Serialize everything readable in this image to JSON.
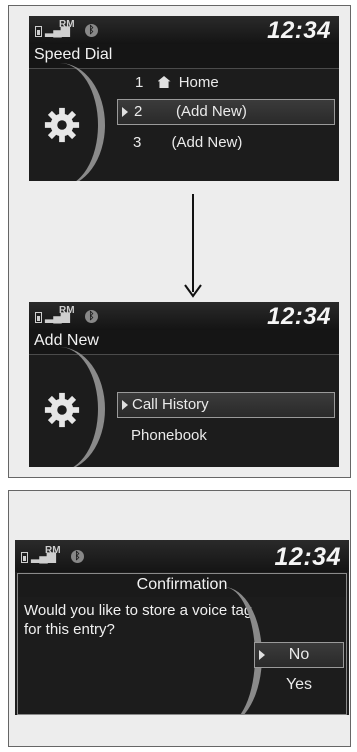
{
  "screens": {
    "speed_dial": {
      "clock": "12:34",
      "status_rm": "RM",
      "title": "Speed Dial",
      "items": [
        {
          "num": "1",
          "label": "Home"
        },
        {
          "num": "2",
          "label": "(Add New)"
        },
        {
          "num": "3",
          "label": "(Add New)"
        }
      ]
    },
    "add_new": {
      "clock": "12:34",
      "status_rm": "RM",
      "title": "Add New",
      "items": [
        {
          "label": "Call History"
        },
        {
          "label": "Phonebook"
        }
      ]
    },
    "confirmation": {
      "clock": "12:34",
      "status_rm": "RM",
      "title": "Confirmation",
      "question": "Would you like to store a voice tag for this entry?",
      "options": [
        {
          "label": "No"
        },
        {
          "label": "Yes"
        }
      ]
    }
  },
  "icons": [
    "battery-icon",
    "signal-icon",
    "bluetooth-icon",
    "gear-icon",
    "home-icon",
    "down-arrow-icon",
    "selection-arrow-icon"
  ]
}
